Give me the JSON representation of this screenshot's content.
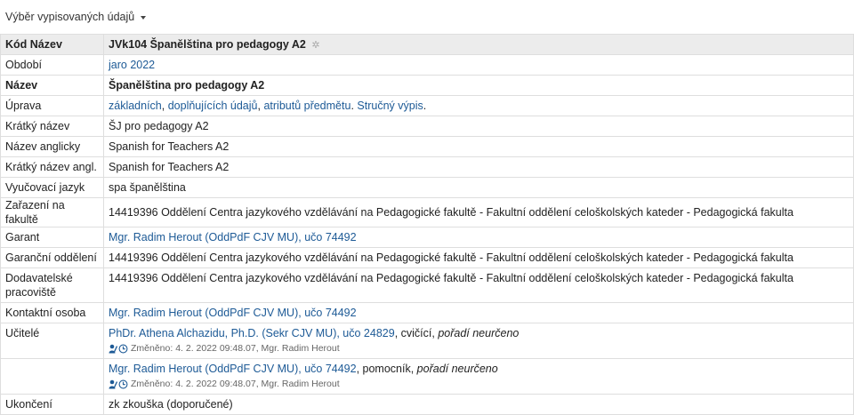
{
  "top": {
    "toggle_label": "Výběr vypisovaných údajů"
  },
  "header": {
    "label": "Kód Název",
    "code": "JVk104",
    "name": "Španělština pro pedagogy A2"
  },
  "rows": {
    "obdobi": {
      "label": "Období",
      "value": "jaro 2022"
    },
    "nazev": {
      "label": "Název",
      "value": "Španělština pro pedagogy A2"
    },
    "uprava": {
      "label": "Úprava",
      "links": [
        "základních",
        "doplňujících údajů",
        "atributů předmětu",
        "Stručný výpis"
      ],
      "sep1": ", ",
      "sep2": ", ",
      "sep3": ". ",
      "end": "."
    },
    "kratky": {
      "label": "Krátký název",
      "value": "ŠJ pro pedagogy A2"
    },
    "anglicky": {
      "label": "Název anglicky",
      "value": "Spanish for Teachers A2"
    },
    "kratky_angl": {
      "label": "Krátký název angl.",
      "value": "Spanish for Teachers A2"
    },
    "jazyk": {
      "label": "Vyučovací jazyk",
      "value": "spa španělština"
    },
    "zarazeni": {
      "label": "Zařazení na fakultě",
      "value": "14419396 Oddělení Centra jazykového vzdělávání na Pedagogické fakultě - Fakultní oddělení celoškolských kateder - Pedagogická fakulta"
    },
    "garant": {
      "label": "Garant",
      "value": "Mgr. Radim Herout (OddPdF CJV MU), učo 74492"
    },
    "garancni": {
      "label": "Garanční oddělení",
      "value": "14419396 Oddělení Centra jazykového vzdělávání na Pedagogické fakultě - Fakultní oddělení celoškolských kateder - Pedagogická fakulta"
    },
    "dodavatelske": {
      "label": "Dodavatelské pracoviště",
      "value": "14419396 Oddělení Centra jazykového vzdělávání na Pedagogické fakultě - Fakultní oddělení celoškolských kateder - Pedagogická fakulta"
    },
    "kontaktni": {
      "label": "Kontaktní osoba",
      "value": "Mgr. Radim Herout (OddPdF CJV MU), učo 74492"
    },
    "ucitele": {
      "label": "Učitelé",
      "items": [
        {
          "name": "PhDr. Athena Alchazidu, Ph.D. (Sekr CJV MU), učo 24829",
          "role": ", cvičící, ",
          "order": "pořadí neurčeno",
          "changed": "Změněno: 4. 2. 2022 09:48.07, Mgr. Radim Herout"
        },
        {
          "name": "Mgr. Radim Herout (OddPdF CJV MU), učo 74492",
          "role": ", pomocník, ",
          "order": "pořadí neurčeno",
          "changed": "Změněno: 4. 2. 2022 09:48.07, Mgr. Radim Herout"
        }
      ]
    },
    "ukonceni": {
      "label": "Ukončení",
      "value": "zk zkouška (doporučené)"
    }
  },
  "icons": {
    "gear": "gear-icon",
    "edit": "person-edit-icon",
    "history": "history-icon",
    "caret": "caret-down-icon"
  },
  "colors": {
    "link": "#1d5a96",
    "header_bg": "#ececec",
    "border": "#dedede"
  }
}
